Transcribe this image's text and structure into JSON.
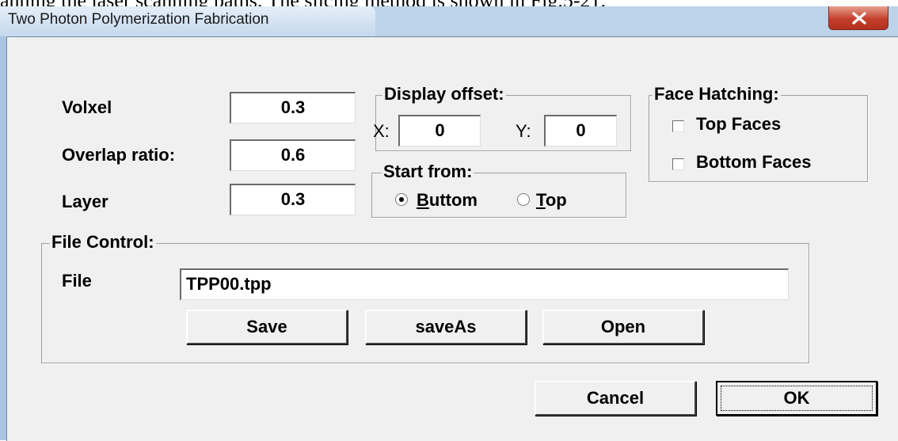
{
  "page_caption": "anning the laser scanning paths. The slicing method is shown in Fig.5-21.",
  "window": {
    "title": "Two Photon Polymerization Fabrication",
    "close_icon": "close-icon"
  },
  "params": {
    "volxel_label": "Volxel",
    "volxel_value": "0.3",
    "overlap_label": "Overlap ratio:",
    "overlap_value": "0.6",
    "layer_label": "Layer",
    "layer_value": "0.3"
  },
  "display_offset": {
    "legend": "Display offset:",
    "x_label": "X:",
    "x_value": "0",
    "y_label": "Y:",
    "y_value": "0"
  },
  "start_from": {
    "legend": "Start from:",
    "options": [
      {
        "label": "Buttom",
        "selected": true
      },
      {
        "label": "Top",
        "selected": false
      }
    ]
  },
  "face_hatching": {
    "legend": "Face Hatching:",
    "options": [
      {
        "label": "Top Faces",
        "checked": false
      },
      {
        "label": "Bottom Faces",
        "checked": false
      }
    ]
  },
  "file_control": {
    "legend": "File Control:",
    "file_label": "File",
    "file_value": "TPP00.tpp",
    "save_label": "Save",
    "save_as_label": "saveAs",
    "open_label": "Open"
  },
  "dialog_buttons": {
    "cancel_label": "Cancel",
    "ok_label": "OK"
  }
}
